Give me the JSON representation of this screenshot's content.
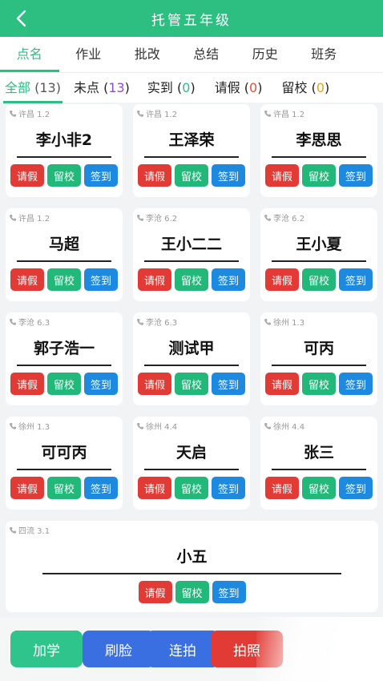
{
  "header": {
    "title": "托管五年级",
    "back_icon": "chevron-left-icon"
  },
  "tabs": [
    {
      "label": "点名",
      "active": true
    },
    {
      "label": "作业"
    },
    {
      "label": "批改"
    },
    {
      "label": "总结"
    },
    {
      "label": "历史"
    },
    {
      "label": "班务"
    }
  ],
  "filters": [
    {
      "label": "全部",
      "count": "13",
      "active": true
    },
    {
      "label": "未点",
      "count": "13"
    },
    {
      "label": "实到",
      "count": "0"
    },
    {
      "label": "请假",
      "count": "0"
    },
    {
      "label": "留校",
      "count": "0"
    }
  ],
  "action_labels": {
    "leave": "请假",
    "stay": "留校",
    "signin": "签到"
  },
  "students": [
    {
      "name": "李小非2",
      "location": "许昌 1.2"
    },
    {
      "name": "王泽荣",
      "location": "许昌 1.2"
    },
    {
      "name": "李思思",
      "location": "许昌 1.2"
    },
    {
      "name": "马超",
      "location": "许昌 1.2"
    },
    {
      "name": "王小二二",
      "location": "李沧 6.2"
    },
    {
      "name": "王小夏",
      "location": "李沧 6.2"
    },
    {
      "name": "郭子浩一",
      "location": "李沧 6.3"
    },
    {
      "name": "测试甲",
      "location": "李沧 6.3"
    },
    {
      "name": "可丙",
      "location": "徐州 1.3"
    },
    {
      "name": "可可丙",
      "location": "徐州 1.3"
    },
    {
      "name": "天启",
      "location": "徐州 4.4"
    },
    {
      "name": "张三",
      "location": "徐州 4.4"
    },
    {
      "name": "小五",
      "location": "四流 3.1"
    }
  ],
  "bottom_actions": [
    {
      "label": "加学",
      "color": "#2fc48b"
    },
    {
      "label": "刷脸",
      "color": "#3a6fe2"
    },
    {
      "label": "连拍",
      "color": "#3a6fe2"
    },
    {
      "label": "拍照",
      "color": "#e23b35"
    }
  ],
  "colors": {
    "primary": "#2dbf81",
    "red": "#e23b35",
    "green": "#21b879",
    "blue": "#1d8ae0"
  }
}
